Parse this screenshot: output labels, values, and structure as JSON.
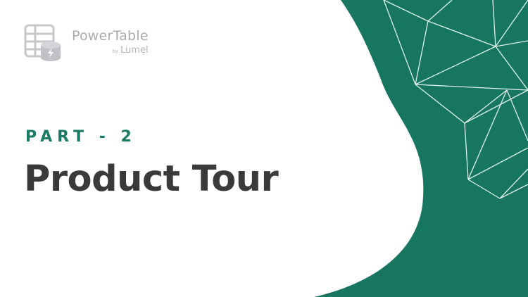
{
  "slide": {
    "logo": {
      "name": "PowerTable",
      "by": "by",
      "brand": "Lumel"
    },
    "part_label": "PART - 2",
    "title": "Product Tour"
  },
  "colors": {
    "accent_green": "#16765f",
    "line_color": "#dff1ea",
    "title_text": "#3a3a3a",
    "logo_gray": "#a9abae"
  },
  "icons": {
    "logo_icon": "table-database-bolt-icon"
  }
}
